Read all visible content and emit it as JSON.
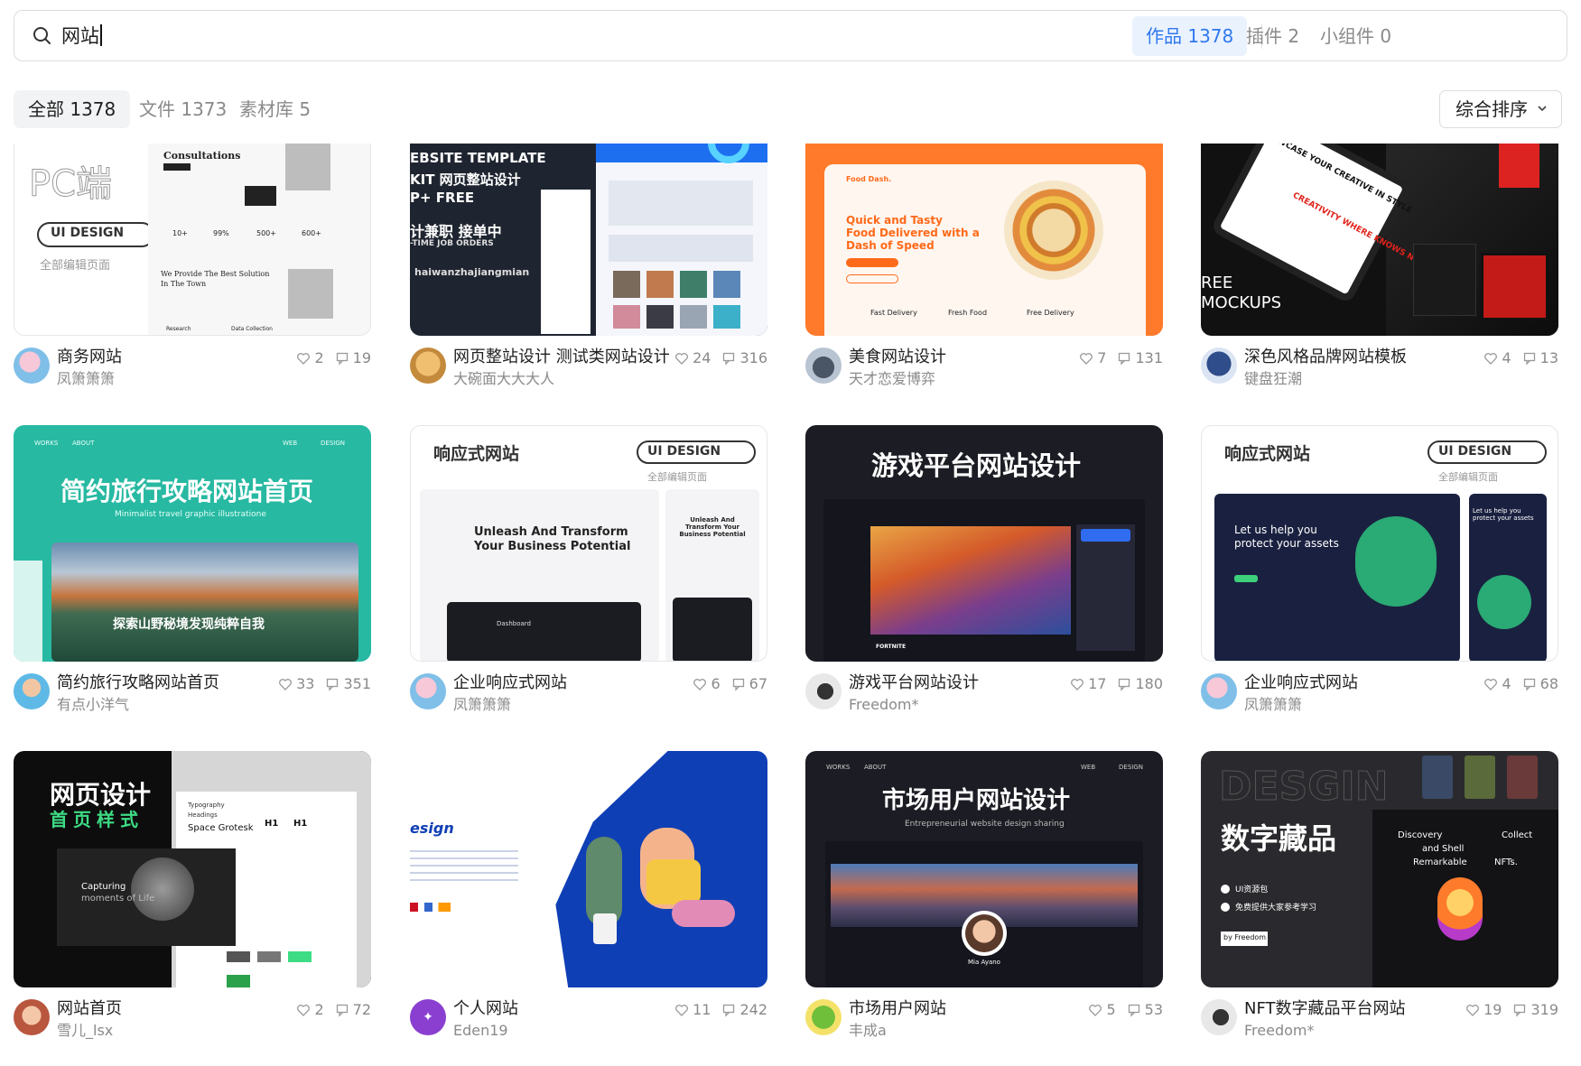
{
  "search": {
    "query": "网站",
    "tabs": [
      {
        "label": "作品 1378",
        "active": true
      },
      {
        "label": "插件 2",
        "active": false
      },
      {
        "label": "小组件 0",
        "active": false
      }
    ]
  },
  "filters": [
    {
      "label": "全部 1378",
      "active": true
    },
    {
      "label": "文件 1373",
      "active": false
    },
    {
      "label": "素材库 5",
      "active": false
    }
  ],
  "sort": {
    "label": "综合排序"
  },
  "cards": [
    {
      "title": "商务网站",
      "author": "凤箫箫箫",
      "likes": "2",
      "comments": "19",
      "thumb": {
        "texts": [
          "PC端",
          "UI DESIGN",
          "全部编辑页面",
          "Consultations",
          "10+",
          "99%",
          "500+",
          "600+",
          "We Provide The Best Solution",
          "In The Town",
          "Research",
          "Data Collection"
        ]
      }
    },
    {
      "title": "网页整站设计 测试类网站设计",
      "author": "大碗面大大大人",
      "likes": "24",
      "comments": "316",
      "thumb": {
        "texts": [
          "EBSITE TEMPLATE",
          "KIT 网页整站设计",
          "P+ FREE",
          "计兼职 接单中",
          "-TIME JOB ORDERS",
          "haiwanzhajiangmian"
        ]
      }
    },
    {
      "title": "美食网站设计",
      "author": "天才恋爱博弈",
      "likes": "7",
      "comments": "131",
      "thumb": {
        "texts": [
          "Food Dash.",
          "Quick and Tasty",
          "Food Delivered with a",
          "Dash of Speed",
          "Fast Delivery",
          "Fresh Food",
          "Free Delivery"
        ]
      }
    },
    {
      "title": "深色风格品牌网站模板",
      "author": "键盘狂潮",
      "likes": "4",
      "comments": "13",
      "thumb": {
        "texts": [
          "SHOWCASE YOUR CREATIVE IN STYLE",
          "CREATIVITY WHERE KNOWS NO BOUNDS.",
          "REE",
          "MOCKUPS"
        ]
      }
    },
    {
      "title": "简约旅行攻略网站首页",
      "author": "有点小洋气",
      "likes": "33",
      "comments": "351",
      "thumb": {
        "texts": [
          "WORKS",
          "ABOUT",
          "WEB",
          "DESIGN",
          "简约旅行攻略网站首页",
          "Minimalist travel graphic illustratione",
          "探索山野秘境发现纯粹自我"
        ]
      }
    },
    {
      "title": "企业响应式网站",
      "author": "凤箫箫箫",
      "likes": "6",
      "comments": "67",
      "thumb": {
        "texts": [
          "响应式网站",
          "UI DESIGN",
          "全部编辑页面",
          "Unleash And Transform",
          "Your Business Potential",
          "Unleash And Transform Your Business Potential",
          "Dashboard"
        ]
      }
    },
    {
      "title": "游戏平台网站设计",
      "author": "Freedom*",
      "likes": "17",
      "comments": "180",
      "thumb": {
        "texts": [
          "游戏平台网站设计",
          "FORTNITE"
        ]
      }
    },
    {
      "title": "企业响应式网站",
      "author": "凤箫箫箫",
      "likes": "4",
      "comments": "68",
      "thumb": {
        "texts": [
          "响应式网站",
          "UI DESIGN",
          "全部编辑页面",
          "Let us help you",
          "protect your assets",
          "Let us help you protect your assets"
        ]
      }
    },
    {
      "title": "网站首页",
      "author": "雪儿_lsx",
      "likes": "2",
      "comments": "72",
      "thumb": {
        "texts": [
          "网页设计",
          "首页样式",
          "Typography",
          "Headings",
          "Space Grotesk",
          "H1",
          "H1",
          "Capturing",
          "moments of Life"
        ]
      }
    },
    {
      "title": "个人网站",
      "author": "Eden19",
      "likes": "11",
      "comments": "242",
      "thumb": {
        "texts": [
          "esign"
        ]
      }
    },
    {
      "title": "市场用户网站",
      "author": "丰成a",
      "likes": "5",
      "comments": "53",
      "thumb": {
        "texts": [
          "WORKS",
          "ABOUT",
          "WEB",
          "DESIGN",
          "市场用户网站设计",
          "Entrepreneurial website design sharing",
          "Mia Ayano"
        ]
      }
    },
    {
      "title": "NFT数字藏品平台网站",
      "author": "Freedom*",
      "likes": "19",
      "comments": "319",
      "thumb": {
        "texts": [
          "DESGIN",
          "数字藏品",
          "UI资源包",
          "免费提供大家参考学习",
          "by Freedom",
          "Discovery",
          "Collect",
          "and Shell",
          "Remarkable",
          "NFTs."
        ]
      }
    }
  ]
}
